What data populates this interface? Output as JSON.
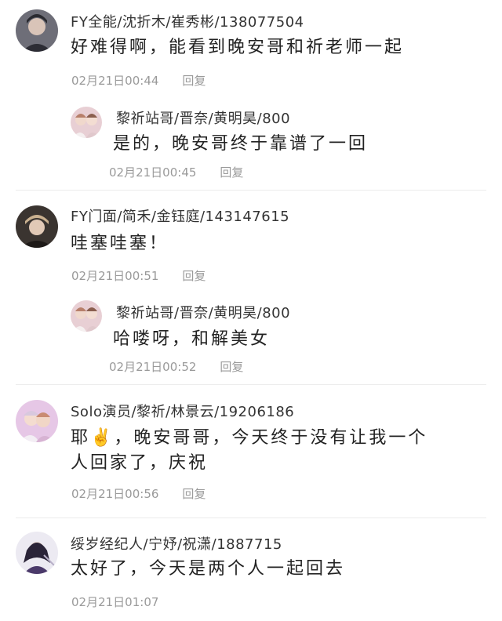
{
  "comments": [
    {
      "name": "FY全能/沈折木/崔秀彬/138077504",
      "text": "好难得啊，能看到晚安哥和祈老师一起",
      "time": "02月21日00:44",
      "reply_label": "回复",
      "reply": {
        "name": "黎祈站哥/晋奈/黄明昊/800",
        "text": "是的，晚安哥终于靠谱了一回",
        "time": "02月21日00:45",
        "reply_label": "回复"
      }
    },
    {
      "name": "FY门面/简禾/金钰庭/143147615",
      "text": "哇塞哇塞！",
      "time": "02月21日00:51",
      "reply_label": "回复",
      "reply": {
        "name": "黎祈站哥/晋奈/黄明昊/800",
        "text": "哈喽呀，和解美女",
        "time": "02月21日00:52",
        "reply_label": "回复"
      }
    },
    {
      "name": "Solo演员/黎祈/林景云/19206186",
      "text_line1": "耶✌️，晚安哥哥，今天终于没有让我一个",
      "text_line2": "人回家了，庆祝",
      "time": "02月21日00:56",
      "reply_label": "回复"
    },
    {
      "name": "绥岁经纪人/宁妤/祝潇/1887715",
      "text": "太好了，今天是两个人一起回去",
      "time": "02月21日01:07"
    }
  ]
}
